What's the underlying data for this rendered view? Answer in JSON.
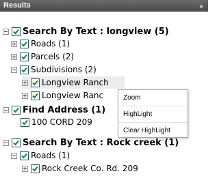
{
  "header": {
    "title": "Results"
  },
  "tree": {
    "group1": {
      "label": "Search By Text : longview (5)",
      "roads": "Roads (1)",
      "parcels": "Parcels (2)",
      "subdivisions": "Subdivisions (2)",
      "sub1": "Longview Ranch",
      "sub2": "Longview Ranc"
    },
    "group2": {
      "label": "Find Address (1)",
      "item1": "100 CORD 209"
    },
    "group3": {
      "label": "Search By Text : Rock creek (1)",
      "roads": "Roads (1)",
      "road1": "Rock Creek Co. Rd. 209"
    }
  },
  "context_menu": {
    "zoom": "Zoom",
    "highlight": "HighLight",
    "clear_highlight": "Clear HighLight"
  }
}
